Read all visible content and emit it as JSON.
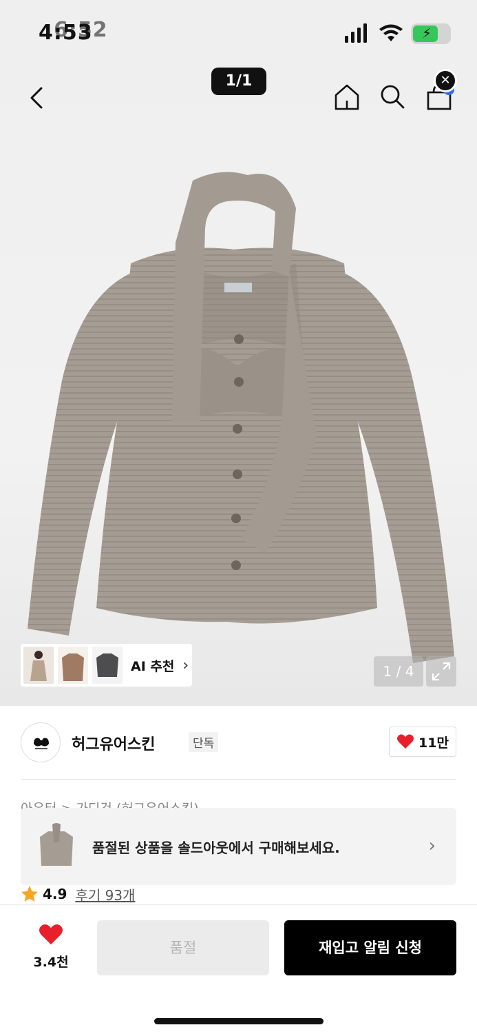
{
  "status_bar": {
    "time": "4:53",
    "time_ghost": "6:52"
  },
  "nav": {
    "image_counter": "1/1"
  },
  "gallery": {
    "page_indicator": "1 / 4",
    "ai_recommend_label": "AI 추천"
  },
  "brand": {
    "name": "허그유어스킨",
    "badge": "단독",
    "likes": "11만"
  },
  "product": {
    "category_path": "아우터 > 가디건 (허그유어스킨)",
    "rating": "4.9",
    "reviews": "후기 93개"
  },
  "soldout_banner": {
    "text": "품절된 상품을 솔드아웃에서 구매해보세요."
  },
  "bottom_bar": {
    "wish_count": "3.4천",
    "soldout_label": "품절",
    "restock_label": "재입고 알림 신청"
  },
  "colors": {
    "accent_red": "#e8202b",
    "star": "#f5a623",
    "primary_button": "#000000",
    "cardigan": "#a59d93"
  }
}
